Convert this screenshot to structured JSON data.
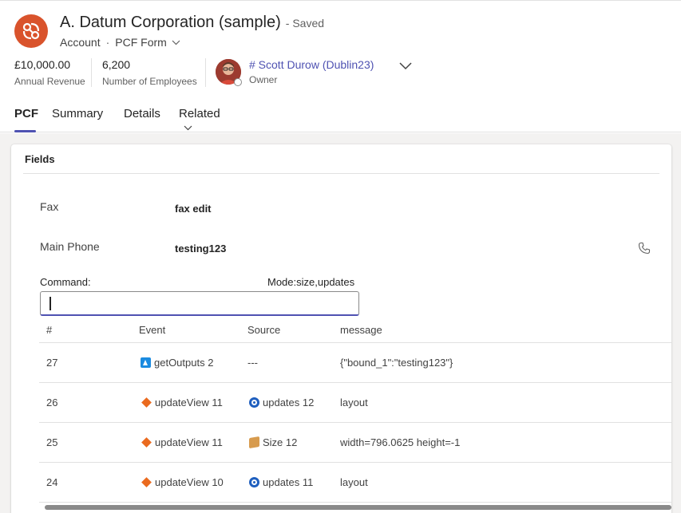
{
  "header": {
    "title": "A. Datum Corporation (sample)",
    "saved_status": "- Saved",
    "entity": "Account",
    "separator": "·",
    "form": "PCF Form",
    "logo_icon": "account-logo-icon",
    "brand_color": "#d9532c",
    "header_fields": [
      {
        "value": "£10,000.00",
        "label": "Annual Revenue"
      },
      {
        "value": "6,200",
        "label": "Number of Employees"
      }
    ],
    "owner": {
      "name": "# Scott Durow (Dublin23)",
      "label": "Owner"
    }
  },
  "tabs": [
    {
      "label": "PCF",
      "active": true
    },
    {
      "label": "Summary",
      "active": false
    },
    {
      "label": "Details",
      "active": false
    },
    {
      "label": "Related",
      "active": false
    }
  ],
  "section": {
    "title": "Fields",
    "fields": [
      {
        "label": "Fax",
        "value": "fax edit"
      },
      {
        "label": "Main Phone",
        "value": "testing123"
      }
    ],
    "command_label": "Command:",
    "mode_label": "Mode:size,updates",
    "command_value": ""
  },
  "log": {
    "columns": [
      "#",
      "Event",
      "Source",
      "message"
    ],
    "rows": [
      {
        "num": "27",
        "event_icon": "output-triangle-icon",
        "event": "getOutputs 2",
        "source_icon": "",
        "source": "---",
        "message": "{\"bound_1\":\"testing123\"}"
      },
      {
        "num": "26",
        "event_icon": "update-diamond-icon",
        "event": "updateView 11",
        "source_icon": "updates-ring-icon",
        "source": "updates 12",
        "message": "layout"
      },
      {
        "num": "25",
        "event_icon": "update-diamond-icon",
        "event": "updateView 11",
        "source_icon": "size-box-icon",
        "source": "Size 12",
        "message": "width=796.0625 height=-1"
      },
      {
        "num": "24",
        "event_icon": "update-diamond-icon",
        "event": "updateView 10",
        "source_icon": "updates-ring-icon",
        "source": "updates 11",
        "message": "layout"
      }
    ]
  }
}
